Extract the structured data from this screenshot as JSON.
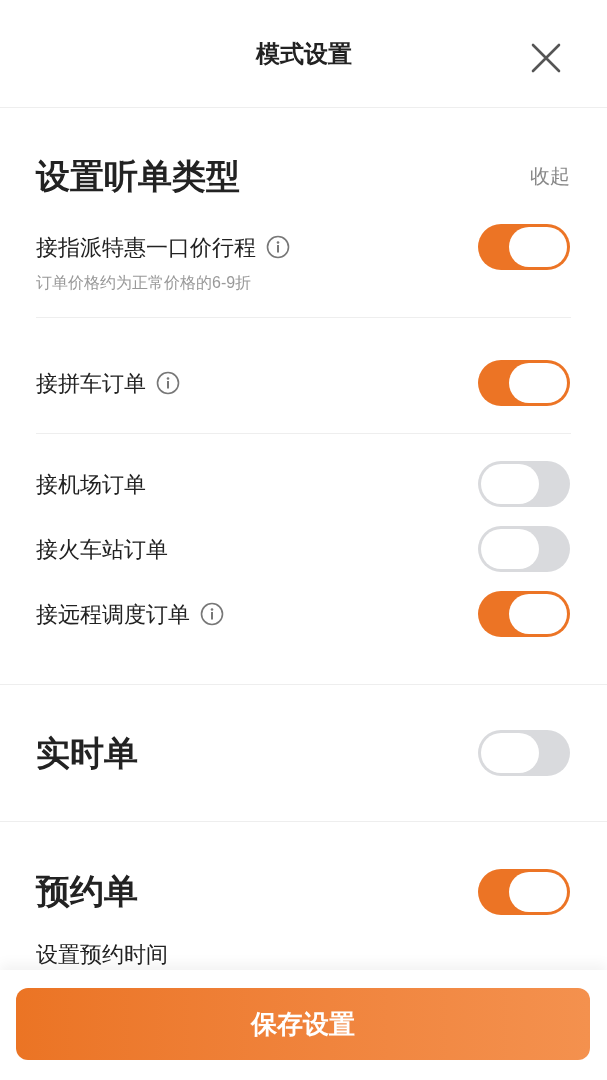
{
  "header": {
    "title": "模式设置"
  },
  "order_types": {
    "title": "设置听单类型",
    "collapse_label": "收起",
    "groups": [
      [
        {
          "label": "接指派特惠一口价行程",
          "info": true,
          "note": "订单价格约为正常价格的6-9折",
          "on": true
        }
      ],
      [
        {
          "label": "接拼车订单",
          "info": true,
          "on": true
        }
      ],
      [
        {
          "label": "接机场订单",
          "info": false,
          "on": false
        },
        {
          "label": "接火车站订单",
          "info": false,
          "on": false
        },
        {
          "label": "接远程调度订单",
          "info": true,
          "on": true
        }
      ]
    ]
  },
  "realtime": {
    "title": "实时单",
    "on": false
  },
  "reservation": {
    "title": "预约单",
    "on": true,
    "time_label": "设置预约时间"
  },
  "save_button": {
    "label": "保存设置"
  }
}
